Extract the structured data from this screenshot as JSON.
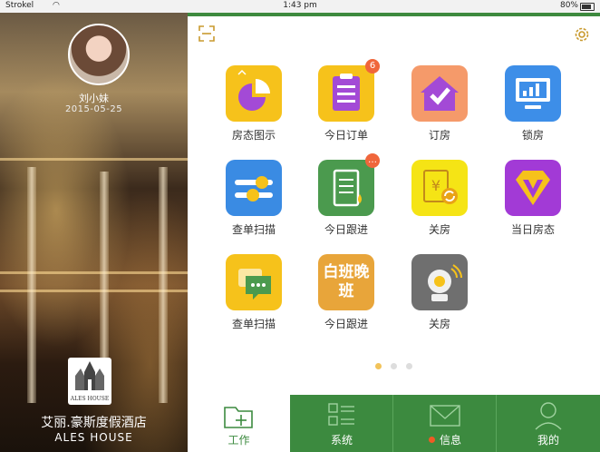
{
  "status_bar": {
    "carrier": "Strokel",
    "time": "1:43 pm",
    "battery": "80%"
  },
  "profile": {
    "name": "刘小妹",
    "date": "2015-05-25"
  },
  "hotel": {
    "logo_text": "ALES HOUSE",
    "name_cn": "艾丽.豪斯度假酒店",
    "name_en": "ALES HOUSE"
  },
  "tiles": [
    {
      "label": "房态图示",
      "icon": "pie-chart-icon",
      "color": "#f6c21b"
    },
    {
      "label": "今日订单",
      "icon": "clipboard-list-icon",
      "color": "#f6c21b",
      "badge": "6"
    },
    {
      "label": "订房",
      "icon": "house-check-icon",
      "color": "#f59a6a"
    },
    {
      "label": "锁房",
      "icon": "monitor-chart-icon",
      "color": "#3d8ee8"
    },
    {
      "label": "查单扫描",
      "icon": "sliders-icon",
      "color": "#3a8be3"
    },
    {
      "label": "今日跟进",
      "icon": "notebook-icon",
      "color": "#4b9a4e",
      "badge": "…"
    },
    {
      "label": "关房",
      "icon": "yen-document-icon",
      "color": "#f5e415"
    },
    {
      "label": "当日房态",
      "icon": "diamond-icon",
      "color": "#a23ad6"
    },
    {
      "label": "查单扫描",
      "icon": "chat-bubble-icon",
      "color": "#f6c21b"
    },
    {
      "label": "今日跟进",
      "icon": "shift-text-icon",
      "color": "#e8a53a",
      "tile_text": "白班晚班"
    },
    {
      "label": "关房",
      "icon": "camera-icon",
      "color": "#6f6f6f"
    }
  ],
  "tabs": [
    {
      "label": "工作",
      "icon": "folder-plus-icon"
    },
    {
      "label": "系统",
      "icon": "list-grid-icon"
    },
    {
      "label": "信息",
      "icon": "envelope-icon"
    },
    {
      "label": "我的",
      "icon": "person-icon"
    }
  ],
  "pager": {
    "pages": 3,
    "current": 1
  }
}
